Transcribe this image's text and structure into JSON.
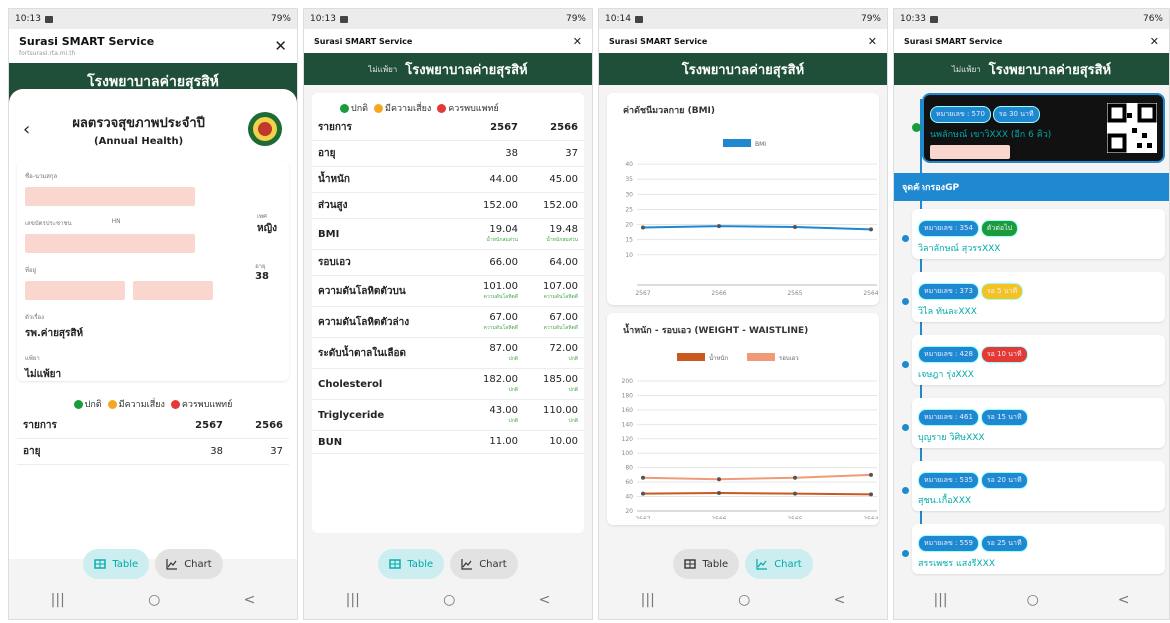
{
  "app": {
    "title": "Surasi SMART Service",
    "subtitle_url": "fortsurasi.rta.mi.th",
    "hospital": "โรงพยาบาลค่ายสุรสิห์",
    "back_label": "ไม่แพ้ยา"
  },
  "phones": [
    {
      "status": {
        "time": "10:13",
        "signal": "79%"
      }
    },
    {
      "status": {
        "time": "10:13",
        "signal": "79%"
      }
    },
    {
      "status": {
        "time": "10:14",
        "signal": "79%"
      }
    },
    {
      "status": {
        "time": "10:33",
        "signal": "76%"
      }
    }
  ],
  "screen1": {
    "page_title": "ผลตรวจสุขภาพประจำปี",
    "page_subtitle": "(Annual Health)",
    "fields": [
      {
        "label": "ชื่อ-นามสกุล"
      },
      {
        "label": "เลขบัตรประชาชน",
        "label2": "HN",
        "label3": "เพศ",
        "value3": "หญิง"
      },
      {
        "label": "ที่อยู่",
        "label3": "อายุ",
        "value3": "38"
      },
      {
        "label": "ตัวเรื่อง",
        "value": "รพ.ค่ายสุรสิห์"
      },
      {
        "label": "แพ้ยา",
        "value": "ไม่แพ้ยา"
      }
    ],
    "table_head": [
      "รายการ",
      "2567",
      "2566"
    ],
    "table_rows": [
      [
        "อายุ",
        "38",
        "37"
      ]
    ]
  },
  "legend": {
    "normal": "ปกติ",
    "risk": "มีความเสี่ยง",
    "doctor": "ควรพบแพทย์",
    "colors": {
      "normal": "#1b9c3a",
      "risk": "#f5a623",
      "doctor": "#e53935"
    }
  },
  "screen2": {
    "table_head": [
      "รายการ",
      "2567",
      "2566"
    ],
    "rows": [
      {
        "name": "อายุ",
        "a": "38",
        "b": "37",
        "sa": "",
        "sb": ""
      },
      {
        "name": "น้ำหนัก",
        "a": "44.00",
        "b": "45.00",
        "sa": "",
        "sb": ""
      },
      {
        "name": "ส่วนสูง",
        "a": "152.00",
        "b": "152.00",
        "sa": "",
        "sb": ""
      },
      {
        "name": "BMI",
        "a": "19.04",
        "b": "19.48",
        "sa": "น้ำหนักสมส่วน",
        "sb": "น้ำหนักสมส่วน"
      },
      {
        "name": "รอบเอว",
        "a": "66.00",
        "b": "64.00",
        "sa": "",
        "sb": ""
      },
      {
        "name": "ความดันโลหิตตัวบน",
        "a": "101.00",
        "b": "107.00",
        "sa": "ความดันโลหิตดี",
        "sb": "ความดันโลหิตดี"
      },
      {
        "name": "ความดันโลหิตตัวล่าง",
        "a": "67.00",
        "b": "67.00",
        "sa": "ความดันโลหิตดี",
        "sb": "ความดันโลหิตดี"
      },
      {
        "name": "ระดับน้ำตาลในเลือด",
        "a": "87.00",
        "b": "72.00",
        "sa": "ปกติ",
        "sb": "ปกติ"
      },
      {
        "name": "Cholesterol",
        "a": "182.00",
        "b": "185.00",
        "sa": "ปกติ",
        "sb": "ปกติ"
      },
      {
        "name": "Triglyceride",
        "a": "43.00",
        "b": "110.00",
        "sa": "ปกติ",
        "sb": "ปกติ"
      },
      {
        "name": "BUN",
        "a": "11.00",
        "b": "10.00",
        "sa": "",
        "sb": ""
      }
    ]
  },
  "toggle": {
    "table": "Table",
    "chart": "Chart"
  },
  "chart_data": [
    {
      "type": "line",
      "title": "ค่าดัชนีมวลกาย (BMI)",
      "categories": [
        "2567",
        "2566",
        "2565",
        "2564"
      ],
      "series": [
        {
          "name": "BMI",
          "values": [
            19.04,
            19.48,
            19.2,
            18.4
          ],
          "color": "#1e88d0"
        }
      ],
      "ylim": [
        0,
        45
      ],
      "yticks": [
        "10",
        "15",
        "20",
        "25",
        "30",
        "35",
        "40"
      ],
      "grid": true,
      "legend": "top"
    },
    {
      "type": "line",
      "title": "น้ำหนัก - รอบเอว (WEIGHT - WAISTLINE)",
      "categories": [
        "2567",
        "2566",
        "2565",
        "2564"
      ],
      "series": [
        {
          "name": "น้ำหนัก",
          "values": [
            44,
            45,
            44,
            43
          ],
          "color": "#c85a1f"
        },
        {
          "name": "รอบเอว",
          "values": [
            66,
            64,
            66,
            70
          ],
          "color": "#f09a78"
        }
      ],
      "ylim": [
        20,
        200
      ],
      "yticks": [
        "20",
        "40",
        "60",
        "80",
        "100",
        "120",
        "140",
        "160",
        "180",
        "200"
      ],
      "grid": true,
      "legend": "top"
    }
  ],
  "screen4": {
    "current": {
      "queue": "หมายเลข : 570",
      "wait": "รอ 30 นาที",
      "name": "นพลักษณ์ เขาวิXXX (อีก 6 คิว)"
    },
    "point": "จุดคัดกรองGP",
    "queue": [
      {
        "queue": "หมายเลข : 354",
        "tag": "ตัวต่อไป",
        "color": "#1b9c3a",
        "name": "วิลาลักษณ์ สุวรรXXX"
      },
      {
        "queue": "หมายเลข : 373",
        "tag": "รอ 5 นาที",
        "color": "#f5c223",
        "name": "วิไล ทันละXXX"
      },
      {
        "queue": "หมายเลข : 428",
        "tag": "รอ 10 นาที",
        "color": "#e53935",
        "name": "เจษฎา รุ่งXXX"
      },
      {
        "queue": "หมายเลข : 461",
        "tag": "รอ 15 นาที",
        "color": "#1e88d0",
        "name": "บุญราย วิศิษXXX"
      },
      {
        "queue": "หมายเลข : 535",
        "tag": "รอ 20 นาที",
        "color": "#1e88d0",
        "name": "สุชน.เกื้อXXX"
      },
      {
        "queue": "หมายเลข : 559",
        "tag": "รอ 25 นาที",
        "color": "#1e88d0",
        "name": "สรรเพชร แสงรีXXX"
      }
    ]
  },
  "nav": {
    "recent": "|||",
    "home": "○",
    "back": "<"
  }
}
